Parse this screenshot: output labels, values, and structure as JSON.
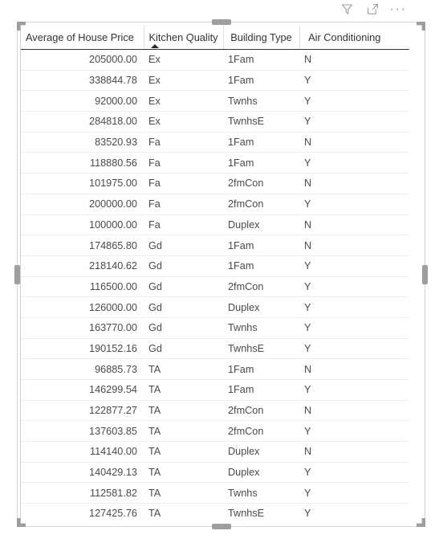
{
  "visual": {
    "type": "table-visual",
    "toolbar": {
      "filter_icon": "filter-funnel-icon",
      "focus_icon": "focus-mode-icon",
      "more_options_icon": "more-options-icon",
      "more_options_label": "···"
    },
    "sort": {
      "column": "Kitchen Quality",
      "direction": "ascending",
      "glyph": "▲"
    }
  },
  "table": {
    "columns": [
      {
        "key": "avg_price",
        "label": "Average of House Price",
        "align": "right"
      },
      {
        "key": "kitchen_quality",
        "label": "Kitchen Quality",
        "align": "left"
      },
      {
        "key": "building_type",
        "label": "Building Type",
        "align": "left"
      },
      {
        "key": "air_conditioning",
        "label": "Air Conditioning",
        "align": "left"
      }
    ],
    "rows": [
      {
        "avg_price": "205000.00",
        "kitchen_quality": "Ex",
        "building_type": "1Fam",
        "air_conditioning": "N"
      },
      {
        "avg_price": "338844.78",
        "kitchen_quality": "Ex",
        "building_type": "1Fam",
        "air_conditioning": "Y"
      },
      {
        "avg_price": "92000.00",
        "kitchen_quality": "Ex",
        "building_type": "Twnhs",
        "air_conditioning": "Y"
      },
      {
        "avg_price": "284818.00",
        "kitchen_quality": "Ex",
        "building_type": "TwnhsE",
        "air_conditioning": "Y"
      },
      {
        "avg_price": "83520.93",
        "kitchen_quality": "Fa",
        "building_type": "1Fam",
        "air_conditioning": "N"
      },
      {
        "avg_price": "118880.56",
        "kitchen_quality": "Fa",
        "building_type": "1Fam",
        "air_conditioning": "Y"
      },
      {
        "avg_price": "101975.00",
        "kitchen_quality": "Fa",
        "building_type": "2fmCon",
        "air_conditioning": "N"
      },
      {
        "avg_price": "200000.00",
        "kitchen_quality": "Fa",
        "building_type": "2fmCon",
        "air_conditioning": "Y"
      },
      {
        "avg_price": "100000.00",
        "kitchen_quality": "Fa",
        "building_type": "Duplex",
        "air_conditioning": "N"
      },
      {
        "avg_price": "174865.80",
        "kitchen_quality": "Gd",
        "building_type": "1Fam",
        "air_conditioning": "N"
      },
      {
        "avg_price": "218140.62",
        "kitchen_quality": "Gd",
        "building_type": "1Fam",
        "air_conditioning": "Y"
      },
      {
        "avg_price": "116500.00",
        "kitchen_quality": "Gd",
        "building_type": "2fmCon",
        "air_conditioning": "Y"
      },
      {
        "avg_price": "126000.00",
        "kitchen_quality": "Gd",
        "building_type": "Duplex",
        "air_conditioning": "Y"
      },
      {
        "avg_price": "163770.00",
        "kitchen_quality": "Gd",
        "building_type": "Twnhs",
        "air_conditioning": "Y"
      },
      {
        "avg_price": "190152.16",
        "kitchen_quality": "Gd",
        "building_type": "TwnhsE",
        "air_conditioning": "Y"
      },
      {
        "avg_price": "96885.73",
        "kitchen_quality": "TA",
        "building_type": "1Fam",
        "air_conditioning": "N"
      },
      {
        "avg_price": "146299.54",
        "kitchen_quality": "TA",
        "building_type": "1Fam",
        "air_conditioning": "Y"
      },
      {
        "avg_price": "122877.27",
        "kitchen_quality": "TA",
        "building_type": "2fmCon",
        "air_conditioning": "N"
      },
      {
        "avg_price": "137603.85",
        "kitchen_quality": "TA",
        "building_type": "2fmCon",
        "air_conditioning": "Y"
      },
      {
        "avg_price": "114140.00",
        "kitchen_quality": "TA",
        "building_type": "Duplex",
        "air_conditioning": "N"
      },
      {
        "avg_price": "140429.13",
        "kitchen_quality": "TA",
        "building_type": "Duplex",
        "air_conditioning": "Y"
      },
      {
        "avg_price": "112581.82",
        "kitchen_quality": "TA",
        "building_type": "Twnhs",
        "air_conditioning": "Y"
      },
      {
        "avg_price": "127425.76",
        "kitchen_quality": "TA",
        "building_type": "TwnhsE",
        "air_conditioning": "Y"
      }
    ]
  },
  "colors": {
    "header_text": "#333333",
    "cell_text": "#4a4a4a",
    "grid_line": "#ededed",
    "header_rule": "#333333",
    "handle": "#9e9e9e",
    "frame": "#d4d4d4",
    "icon": "#9a9a9a"
  }
}
